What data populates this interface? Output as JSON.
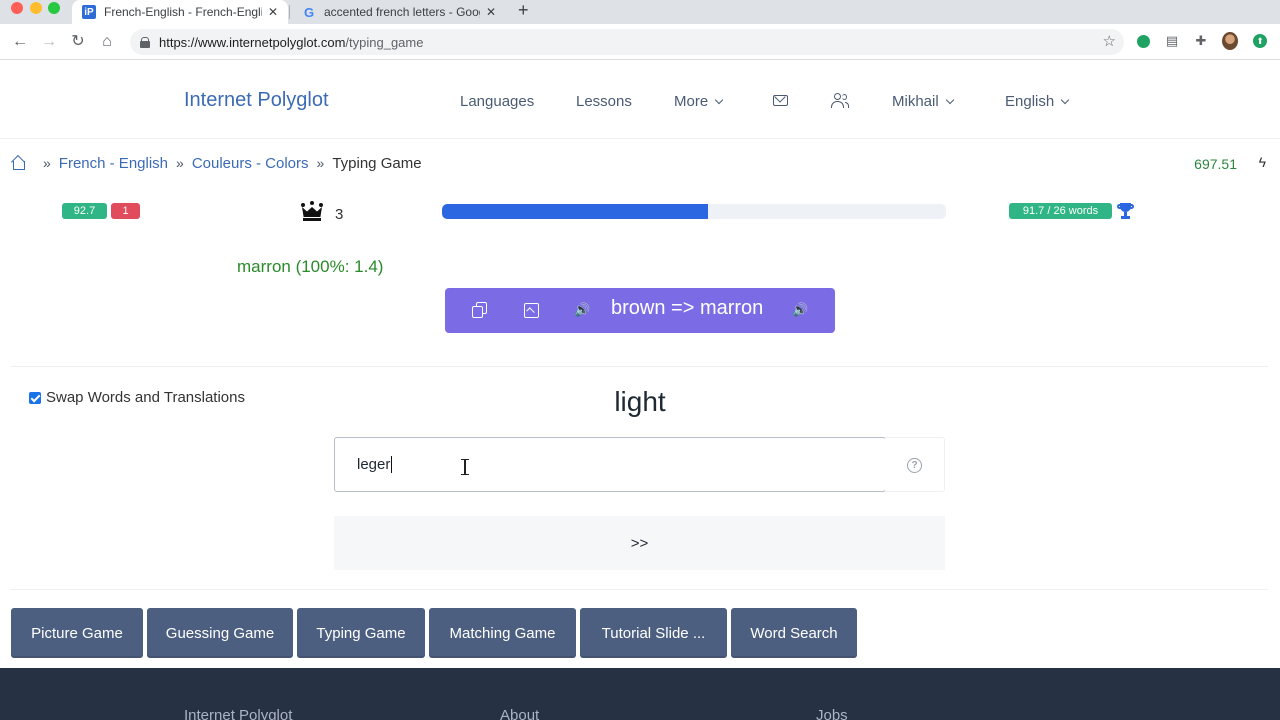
{
  "browser": {
    "tabs": [
      {
        "title": "French-English - French-English",
        "icon": "internet-polyglot-favicon",
        "active": true
      },
      {
        "title": "accented french letters - Google",
        "icon": "google-favicon",
        "active": false
      }
    ],
    "close_glyph": "✕",
    "new_tab_glyph": "+",
    "url_host": "https://www.internetpolyglot.com",
    "url_path": "/typing_game",
    "back_glyph": "←",
    "forward_glyph": "→",
    "reload_glyph": "↻",
    "home_glyph": "⌂",
    "star_glyph": "☆"
  },
  "header": {
    "brand": "Internet Polyglot",
    "nav": {
      "languages": "Languages",
      "lessons": "Lessons",
      "more": "More",
      "user": "Mikhail",
      "language": "English"
    }
  },
  "breadcrumb": {
    "sep": "»",
    "items": [
      "French - English",
      "Couleurs - Colors"
    ],
    "current": "Typing Game"
  },
  "points": "697.51",
  "bolt_glyph": "ϟ",
  "stats": {
    "score": "92.7",
    "errors": "1",
    "streak": "3",
    "progress": 0.527,
    "best": "91.7 / 26 words"
  },
  "last_answer": "marron (100%: 1.4)",
  "answer_card": {
    "text": "brown => marron",
    "speaker_glyph": "🔊"
  },
  "swap_label": "Swap Words and Translations",
  "prompt_word": "light",
  "input_value": "leger",
  "help_glyph": "?",
  "next_label": ">>",
  "games": [
    "Picture Game",
    "Guessing Game",
    "Typing Game",
    "Matching Game",
    "Tutorial Slide ...",
    "Word Search"
  ],
  "footer": [
    "Internet Polyglot",
    "About",
    "Jobs"
  ],
  "colors": {
    "brand": "#3c6bb5",
    "card": "#7b6ce6",
    "progress": "#2b67e0",
    "success": "#2fb586",
    "danger": "#e14c5c",
    "game_button": "#4d5f80",
    "footer": "#263144"
  }
}
